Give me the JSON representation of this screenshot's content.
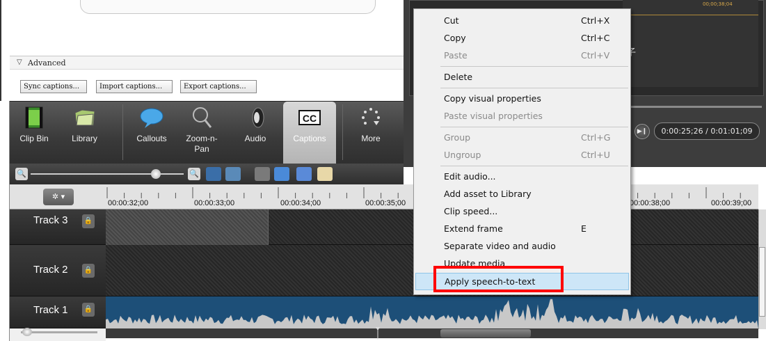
{
  "advanced": {
    "label": "Advanced",
    "buttons": [
      "Sync captions...",
      "Import captions...",
      "Export captions..."
    ]
  },
  "tools": [
    {
      "label": "Clip Bin",
      "icon": "film-strip-icon"
    },
    {
      "label": "Library",
      "icon": "folder-icon"
    },
    {
      "label": "Callouts",
      "icon": "speech-bubble-icon"
    },
    {
      "label": "Zoom-n-\nPan",
      "icon": "magnifier-icon"
    },
    {
      "label": "Audio",
      "icon": "speaker-icon"
    },
    {
      "label": "Captions",
      "icon": "cc-icon",
      "active": true
    },
    {
      "label": "More",
      "icon": "more-dots-icon"
    }
  ],
  "preview": {
    "time_display": "0:00:25;26 / 0:01:01;09",
    "overlay_char": "子",
    "ruler_time": "00;00;38;04"
  },
  "ruler": {
    "ticks": [
      "00:00:32;00",
      "00:00:33;00",
      "00:00:34;00",
      "00:00:35;00",
      "00:00:38;00",
      "00:00:39;00"
    ]
  },
  "tracks": [
    {
      "name": "Track 3"
    },
    {
      "name": "Track 2"
    },
    {
      "name": "Track 1"
    }
  ],
  "context_menu": {
    "items": [
      {
        "label": "Cut",
        "shortcut": "Ctrl+X",
        "enabled": true
      },
      {
        "label": "Copy",
        "shortcut": "Ctrl+C",
        "enabled": true
      },
      {
        "label": "Paste",
        "shortcut": "Ctrl+V",
        "enabled": false
      },
      {
        "label": "Delete",
        "shortcut": "",
        "enabled": true
      },
      {
        "label": "Copy visual properties",
        "shortcut": "",
        "enabled": true
      },
      {
        "label": "Paste visual properties",
        "shortcut": "",
        "enabled": false
      },
      {
        "label": "Group",
        "shortcut": "Ctrl+G",
        "enabled": false
      },
      {
        "label": "Ungroup",
        "shortcut": "Ctrl+U",
        "enabled": false
      },
      {
        "label": "Edit audio...",
        "shortcut": "",
        "enabled": true
      },
      {
        "label": "Add asset to Library",
        "shortcut": "",
        "enabled": true
      },
      {
        "label": "Clip speed...",
        "shortcut": "",
        "enabled": true
      },
      {
        "label": "Extend frame",
        "shortcut": "E",
        "enabled": true
      },
      {
        "label": "Separate video and audio",
        "shortcut": "",
        "enabled": true
      },
      {
        "label": "Update media",
        "shortcut": "",
        "enabled": true
      },
      {
        "label": "Apply speech-to-text",
        "shortcut": "",
        "enabled": true,
        "highlighted": true
      }
    ]
  },
  "colors": {
    "highlight_outline": "#ff0000",
    "menu_hover": "#cde6f7",
    "waveform_bg": "#1d4f78",
    "waveform_fill": "#c8c8c8"
  }
}
